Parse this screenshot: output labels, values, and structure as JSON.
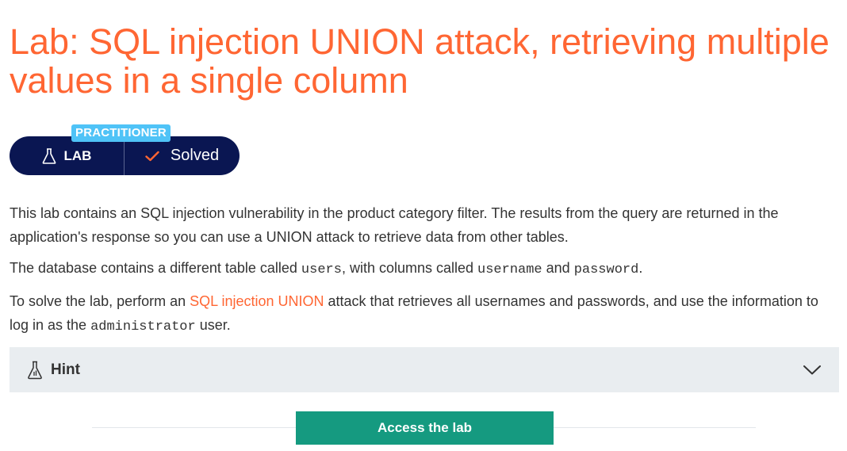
{
  "title": "Lab: SQL injection UNION attack, retrieving multiple values in a single column",
  "level": "PRACTITIONER",
  "status": {
    "lab_label": "LAB",
    "solved_label": "Solved"
  },
  "description": {
    "p1": "This lab contains an SQL injection vulnerability in the product category filter. The results from the query are returned in the application's response so you can use a UNION attack to retrieve data from other tables.",
    "p2_a": "The database contains a different table called ",
    "p2_code1": "users",
    "p2_b": ", with columns called ",
    "p2_code2": "username",
    "p2_c": " and ",
    "p2_code3": "password",
    "p2_d": ".",
    "p3_a": "To solve the lab, perform an ",
    "p3_link": "SQL injection UNION",
    "p3_b": " attack that retrieves all usernames and passwords, and use the information to log in as the ",
    "p3_code": "administrator",
    "p3_c": " user."
  },
  "hint": {
    "label": "Hint"
  },
  "access_button": "Access the lab",
  "colors": {
    "accent": "#ff6633",
    "badge": "#4fc3f7",
    "pill": "#0a1652",
    "button": "#159a80",
    "hint_bg": "#e9edf0"
  },
  "icons": {
    "lab": "flask-icon",
    "solved": "checkmark-icon",
    "hint": "flask-icon",
    "expand": "chevron-down-icon"
  }
}
